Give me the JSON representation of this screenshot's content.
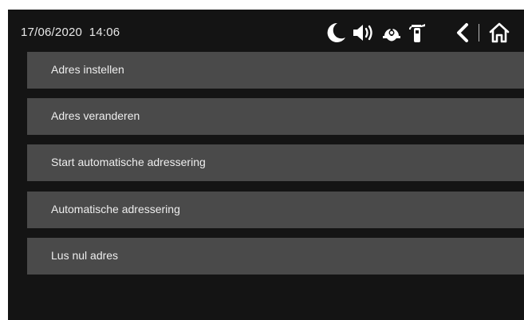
{
  "status_bar": {
    "datetime": "17/06/2020  14:06",
    "icons": [
      "night-mode-icon",
      "volume-icon",
      "firefighter-helmet-icon",
      "fire-extinguisher-icon",
      "back-icon",
      "home-icon"
    ]
  },
  "menu": {
    "items": [
      {
        "label": "Adres instellen"
      },
      {
        "label": "Adres veranderen"
      },
      {
        "label": "Start automatische adressering"
      },
      {
        "label": "Automatische adressering"
      },
      {
        "label": "Lus nul adres"
      }
    ]
  },
  "colors": {
    "background": "#141414",
    "menu_item": "#4a4a4a",
    "text": "#eeeeee"
  }
}
